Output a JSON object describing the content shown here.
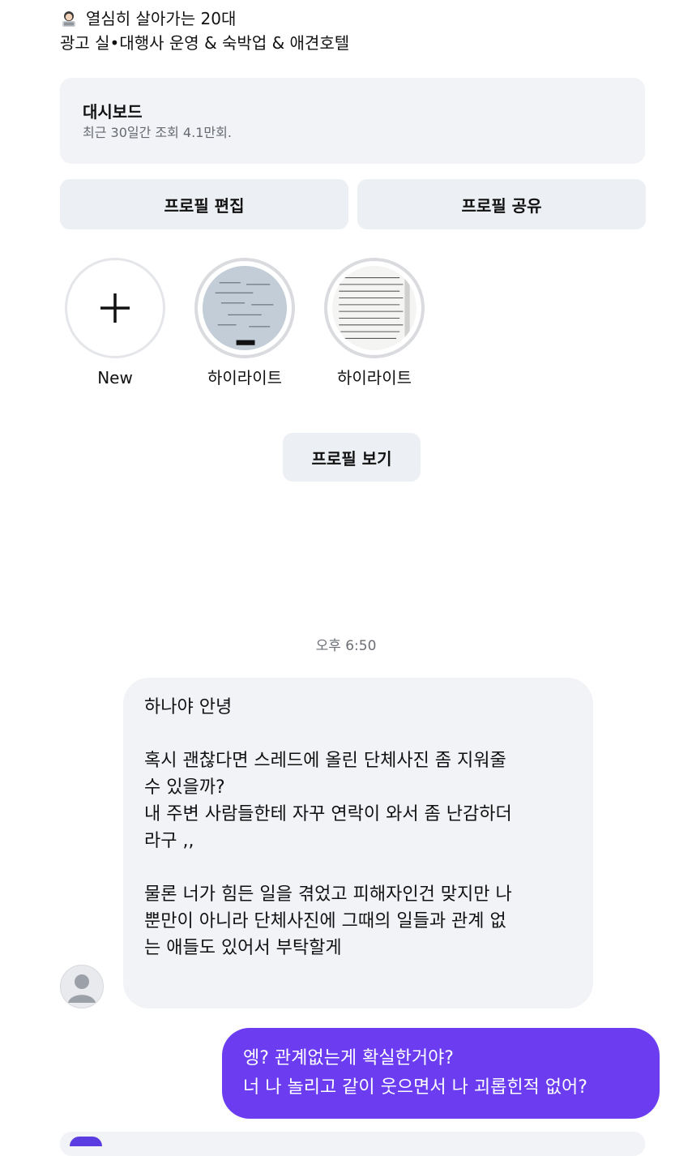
{
  "profile": {
    "bio_line1": "열심히 살아가는 20대",
    "bio_line2": "광고 실•대행사 운영 & 숙박업 & 애견호텔",
    "bio_emoji": "person-with-laptop-emoji"
  },
  "dashboard": {
    "title": "대시보드",
    "subtitle": "최근 30일간 조회 4.1만회."
  },
  "buttons": {
    "edit_profile": "프로필 편집",
    "share_profile": "프로필 공유",
    "view_profile": "프로필 보기"
  },
  "highlights": [
    {
      "label": "New",
      "icon": "plus-icon"
    },
    {
      "label": "하이라이트"
    },
    {
      "label": "하이라이트"
    }
  ],
  "chat": {
    "timestamp": "오후 6:50",
    "incoming": {
      "p1": "하나야 안녕",
      "p2_l1": "혹시 괜찮다면 스레드에 올린 단체사진 좀 지워줄",
      "p2_l2": "수 있을까?",
      "p2_l3": "내 주변 사람들한테 자꾸 연락이 와서 좀 난감하더",
      "p2_l4": "라구 ,,",
      "p3_l1": "물론 너가 힘든 일을 겪었고 피해자인건 맞지만 나",
      "p3_l2": "뿐만이 아니라 단체사진에 그때의 일들과 관계 없",
      "p3_l3": "는 애들도 있어서 부탁할게"
    },
    "outgoing": {
      "l1": "엥? 관계없는게 확실한거야?",
      "l2": "너 나 놀리고 같이 웃으면서 나 괴롭힌적 없어?"
    }
  },
  "colors": {
    "outgoing_bubble": "#6b3cf0",
    "incoming_bubble": "#f1f3f6",
    "button_bg": "#eceff3"
  }
}
